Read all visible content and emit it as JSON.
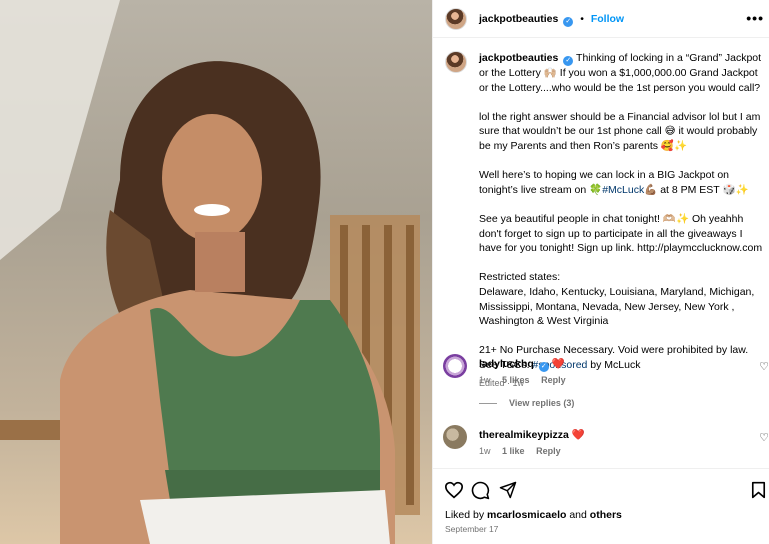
{
  "post": {
    "username": "jackpotbeauties",
    "follow_label": "Follow",
    "more_label": "•••",
    "caption": {
      "p1": "Thinking of locking in a “Grand” Jackpot or the Lottery 🙌🏼 If you won a $1,000,000.00 Grand Jackpot or the Lottery....who would be the 1st person you would call?",
      "p2": "lol the right answer should be a Financial advisor lol but I am sure that wouldn’t be our 1st phone call 😅 it would probably be my Parents and then Ron’s parents 🥰✨",
      "p3_before": "Well here’s to hoping we can lock in a BIG Jackpot on tonight’s live stream on 🍀",
      "p3_hashtag": "#McLuck",
      "p3_after": "💪🏽 at 8 PM EST 🎲✨",
      "p4": "See ya beautiful people in chat tonight! 🫶🏼✨ Oh yeahhh don't forget to sign up to participate in all the giveaways I have for you tonight! Sign up link. http://playmcclucknow.com",
      "p5_title": "Restricted states:",
      "p5_list": "Delaware, Idaho, Kentucky, Louisiana, Maryland, Michigan, Mississippi, Montana, Nevada, New Jersey, New York , Washington & West Virginia",
      "p6_before": "21+ No Purchase Necessary. Void were prohibited by law. See T&Cs.",
      "p6_hashtag": "#sponsored",
      "p6_after": "by McLuck",
      "meta": "Edited · 1w"
    }
  },
  "comments": [
    {
      "username": "ladyluckhq",
      "text": "❤️",
      "age": "1w",
      "likes": "5 likes",
      "reply": "Reply",
      "verified": true
    },
    {
      "username": "therealmikeypizza",
      "text": "❤️",
      "age": "1w",
      "likes": "1 like",
      "reply": "Reply",
      "verified": false
    }
  ],
  "view_replies": "View replies (3)",
  "likes_line": {
    "prefix": "Liked by",
    "user": "mcarlosmicaelo",
    "middle": "and",
    "suffix": "others"
  },
  "date": "September 17",
  "icons": [
    "heart-icon",
    "comment-icon",
    "share-icon",
    "bookmark-icon",
    "verified-icon",
    "more-icon"
  ],
  "colors": {
    "link": "#0095f6",
    "hashtag": "#00376b",
    "muted": "#737373",
    "verified": "#3897f0",
    "top_wear": "#4f7a4f"
  }
}
